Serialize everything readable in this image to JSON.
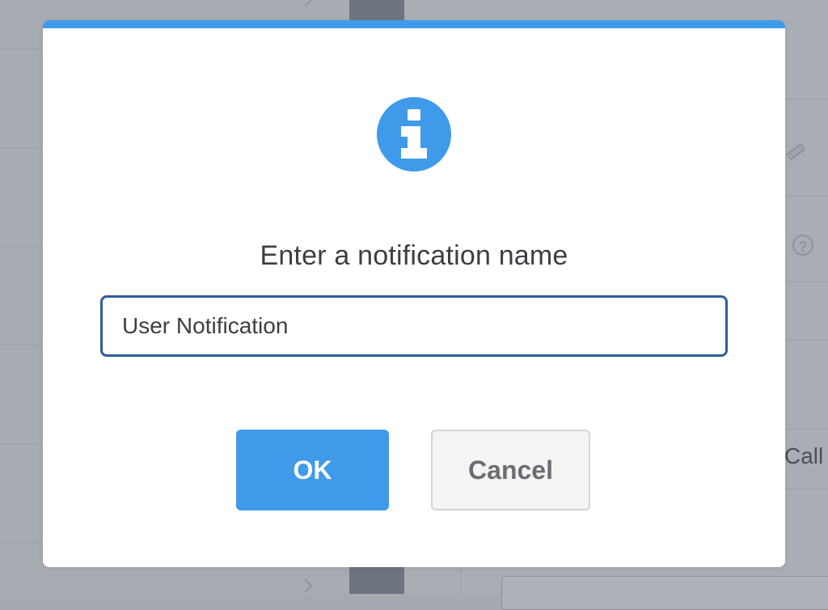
{
  "dialog": {
    "title": "Enter a notification name",
    "input_value": "User Notification",
    "ok_label": "OK",
    "cancel_label": "Cancel",
    "icon": "info-icon",
    "accent_color": "#3f9ae9"
  },
  "background": {
    "partial_text": "Call",
    "icons": [
      "chevron-right-icon",
      "pencil-icon",
      "help-icon"
    ]
  }
}
